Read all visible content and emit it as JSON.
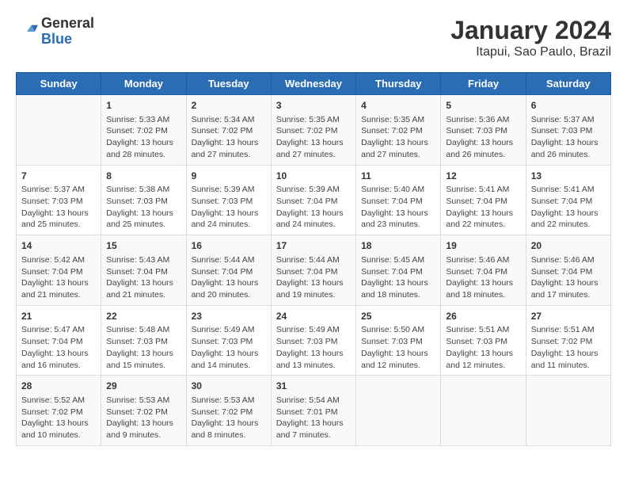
{
  "header": {
    "logo_general": "General",
    "logo_blue": "Blue",
    "title": "January 2024",
    "subtitle": "Itapui, Sao Paulo, Brazil"
  },
  "weekdays": [
    "Sunday",
    "Monday",
    "Tuesday",
    "Wednesday",
    "Thursday",
    "Friday",
    "Saturday"
  ],
  "weeks": [
    [
      {
        "day": "",
        "content": ""
      },
      {
        "day": "1",
        "content": "Sunrise: 5:33 AM\nSunset: 7:02 PM\nDaylight: 13 hours\nand 28 minutes."
      },
      {
        "day": "2",
        "content": "Sunrise: 5:34 AM\nSunset: 7:02 PM\nDaylight: 13 hours\nand 27 minutes."
      },
      {
        "day": "3",
        "content": "Sunrise: 5:35 AM\nSunset: 7:02 PM\nDaylight: 13 hours\nand 27 minutes."
      },
      {
        "day": "4",
        "content": "Sunrise: 5:35 AM\nSunset: 7:02 PM\nDaylight: 13 hours\nand 27 minutes."
      },
      {
        "day": "5",
        "content": "Sunrise: 5:36 AM\nSunset: 7:03 PM\nDaylight: 13 hours\nand 26 minutes."
      },
      {
        "day": "6",
        "content": "Sunrise: 5:37 AM\nSunset: 7:03 PM\nDaylight: 13 hours\nand 26 minutes."
      }
    ],
    [
      {
        "day": "7",
        "content": "Sunrise: 5:37 AM\nSunset: 7:03 PM\nDaylight: 13 hours\nand 25 minutes."
      },
      {
        "day": "8",
        "content": "Sunrise: 5:38 AM\nSunset: 7:03 PM\nDaylight: 13 hours\nand 25 minutes."
      },
      {
        "day": "9",
        "content": "Sunrise: 5:39 AM\nSunset: 7:03 PM\nDaylight: 13 hours\nand 24 minutes."
      },
      {
        "day": "10",
        "content": "Sunrise: 5:39 AM\nSunset: 7:04 PM\nDaylight: 13 hours\nand 24 minutes."
      },
      {
        "day": "11",
        "content": "Sunrise: 5:40 AM\nSunset: 7:04 PM\nDaylight: 13 hours\nand 23 minutes."
      },
      {
        "day": "12",
        "content": "Sunrise: 5:41 AM\nSunset: 7:04 PM\nDaylight: 13 hours\nand 22 minutes."
      },
      {
        "day": "13",
        "content": "Sunrise: 5:41 AM\nSunset: 7:04 PM\nDaylight: 13 hours\nand 22 minutes."
      }
    ],
    [
      {
        "day": "14",
        "content": "Sunrise: 5:42 AM\nSunset: 7:04 PM\nDaylight: 13 hours\nand 21 minutes."
      },
      {
        "day": "15",
        "content": "Sunrise: 5:43 AM\nSunset: 7:04 PM\nDaylight: 13 hours\nand 21 minutes."
      },
      {
        "day": "16",
        "content": "Sunrise: 5:44 AM\nSunset: 7:04 PM\nDaylight: 13 hours\nand 20 minutes."
      },
      {
        "day": "17",
        "content": "Sunrise: 5:44 AM\nSunset: 7:04 PM\nDaylight: 13 hours\nand 19 minutes."
      },
      {
        "day": "18",
        "content": "Sunrise: 5:45 AM\nSunset: 7:04 PM\nDaylight: 13 hours\nand 18 minutes."
      },
      {
        "day": "19",
        "content": "Sunrise: 5:46 AM\nSunset: 7:04 PM\nDaylight: 13 hours\nand 18 minutes."
      },
      {
        "day": "20",
        "content": "Sunrise: 5:46 AM\nSunset: 7:04 PM\nDaylight: 13 hours\nand 17 minutes."
      }
    ],
    [
      {
        "day": "21",
        "content": "Sunrise: 5:47 AM\nSunset: 7:04 PM\nDaylight: 13 hours\nand 16 minutes."
      },
      {
        "day": "22",
        "content": "Sunrise: 5:48 AM\nSunset: 7:03 PM\nDaylight: 13 hours\nand 15 minutes."
      },
      {
        "day": "23",
        "content": "Sunrise: 5:49 AM\nSunset: 7:03 PM\nDaylight: 13 hours\nand 14 minutes."
      },
      {
        "day": "24",
        "content": "Sunrise: 5:49 AM\nSunset: 7:03 PM\nDaylight: 13 hours\nand 13 minutes."
      },
      {
        "day": "25",
        "content": "Sunrise: 5:50 AM\nSunset: 7:03 PM\nDaylight: 13 hours\nand 12 minutes."
      },
      {
        "day": "26",
        "content": "Sunrise: 5:51 AM\nSunset: 7:03 PM\nDaylight: 13 hours\nand 12 minutes."
      },
      {
        "day": "27",
        "content": "Sunrise: 5:51 AM\nSunset: 7:02 PM\nDaylight: 13 hours\nand 11 minutes."
      }
    ],
    [
      {
        "day": "28",
        "content": "Sunrise: 5:52 AM\nSunset: 7:02 PM\nDaylight: 13 hours\nand 10 minutes."
      },
      {
        "day": "29",
        "content": "Sunrise: 5:53 AM\nSunset: 7:02 PM\nDaylight: 13 hours\nand 9 minutes."
      },
      {
        "day": "30",
        "content": "Sunrise: 5:53 AM\nSunset: 7:02 PM\nDaylight: 13 hours\nand 8 minutes."
      },
      {
        "day": "31",
        "content": "Sunrise: 5:54 AM\nSunset: 7:01 PM\nDaylight: 13 hours\nand 7 minutes."
      },
      {
        "day": "",
        "content": ""
      },
      {
        "day": "",
        "content": ""
      },
      {
        "day": "",
        "content": ""
      }
    ]
  ]
}
